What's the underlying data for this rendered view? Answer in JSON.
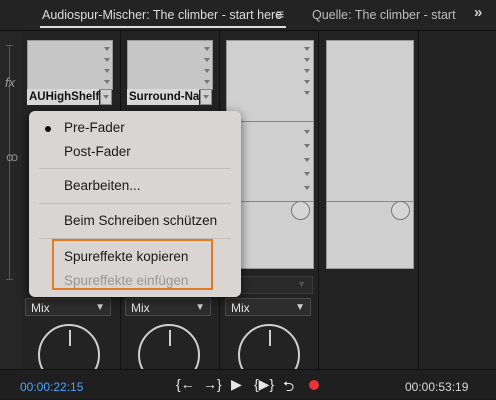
{
  "tabs": [
    {
      "label": "Audiospur-Mischer: The climber - start here",
      "active": true
    },
    {
      "label": "Quelle: The climber - start h",
      "active": false
    }
  ],
  "icons": {
    "tab_menu": "hamburger-icon",
    "overflow": "double-chevron-right-icon"
  },
  "sidebar": {
    "fx_label": "fx"
  },
  "effects": [
    "AUHighShelf",
    "Surround-Nac"
  ],
  "dropdowns": [
    "Mix",
    "Mix",
    "Mix"
  ],
  "context_menu": {
    "items": [
      {
        "label": "Pre-Fader",
        "selected": true,
        "disabled": false
      },
      {
        "label": "Post-Fader",
        "selected": false,
        "disabled": false
      },
      {
        "label": "Bearbeiten...",
        "selected": false,
        "disabled": false
      },
      {
        "label": "Beim Schreiben schützen",
        "selected": false,
        "disabled": false
      },
      {
        "label": "Spureffekte kopieren",
        "selected": false,
        "disabled": false
      },
      {
        "label": "Spureffekte einfügen",
        "selected": false,
        "disabled": true
      }
    ],
    "highlight_color": "#e57b20"
  },
  "transport": {
    "timecode_current": "00:00:22:15",
    "timecode_duration": "00:00:53:19",
    "buttons": [
      {
        "glyph": "{←",
        "icon": "go-to-in-point-icon"
      },
      {
        "glyph": "→}",
        "icon": "go-to-out-point-icon"
      },
      {
        "glyph": "▶",
        "icon": "play-icon"
      },
      {
        "glyph": "{▶}",
        "icon": "play-in-to-out-icon"
      },
      {
        "glyph": "⮌",
        "icon": "loop-icon"
      }
    ],
    "record_color": "#e8333a",
    "current_tc_color": "#4aa3ff"
  }
}
